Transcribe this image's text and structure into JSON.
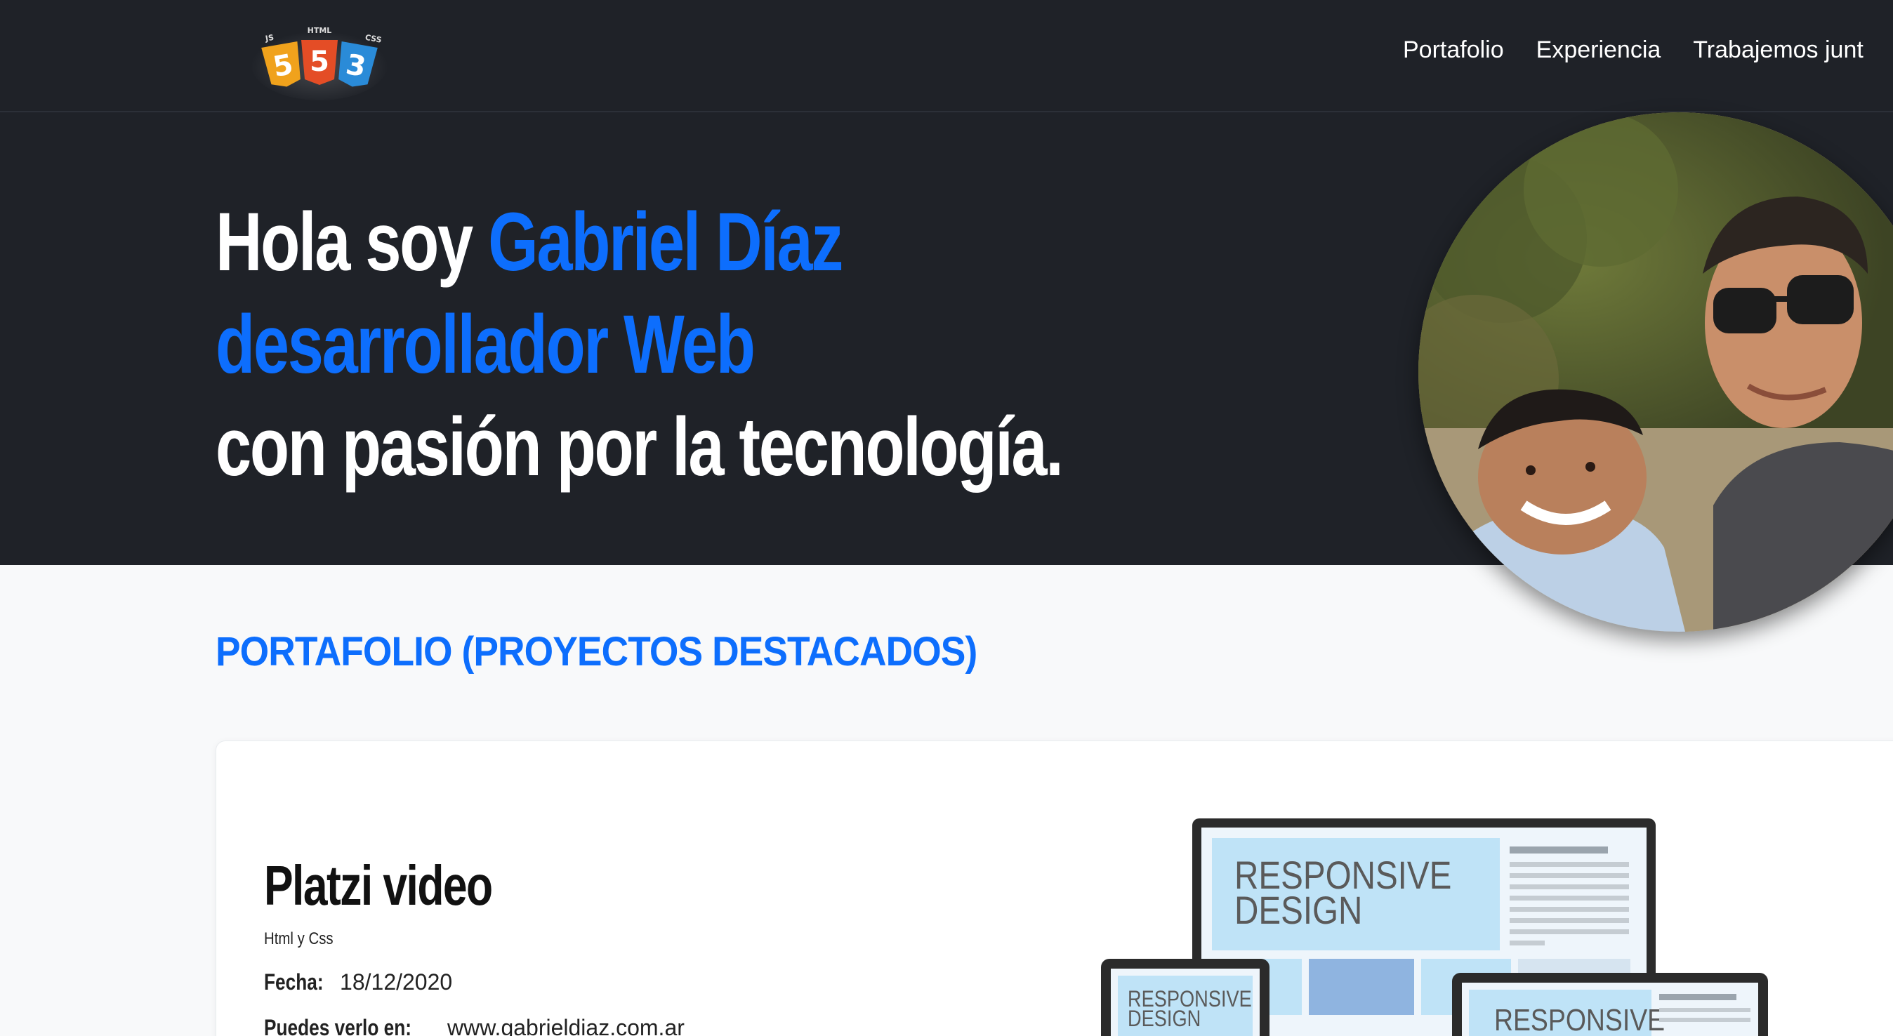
{
  "header": {
    "logo_icon": "html-css-js-logo",
    "logo_labels": {
      "js": "JS",
      "html": "HTML",
      "css": "CSS"
    },
    "nav": [
      {
        "label": "Portafolio"
      },
      {
        "label": "Experiencia"
      },
      {
        "label": "Trabajemos junt"
      }
    ]
  },
  "hero": {
    "line1_prefix": "Hola soy ",
    "line1_name": "Gabriel Díaz",
    "line2": "desarrollador Web",
    "line3": "con pasión por la tecnología.",
    "photo_icon": "profile-photo"
  },
  "portfolio": {
    "title": "PORTAFOLIO (PROYECTOS DESTACADOS)",
    "projects": [
      {
        "name": "Platzi video",
        "tech": "Html y Css",
        "date_label": "Fecha:",
        "date": "18/12/2020",
        "link_label": "Puedes verlo en:",
        "link": "www.gabrieldiaz.com.ar",
        "image_text_1": "RESPONSIVE",
        "image_text_2": "DESIGN"
      }
    ]
  },
  "colors": {
    "accent": "#0d6efd",
    "dark_bg": "#1f2228",
    "page_bg": "#f8f9fa"
  }
}
